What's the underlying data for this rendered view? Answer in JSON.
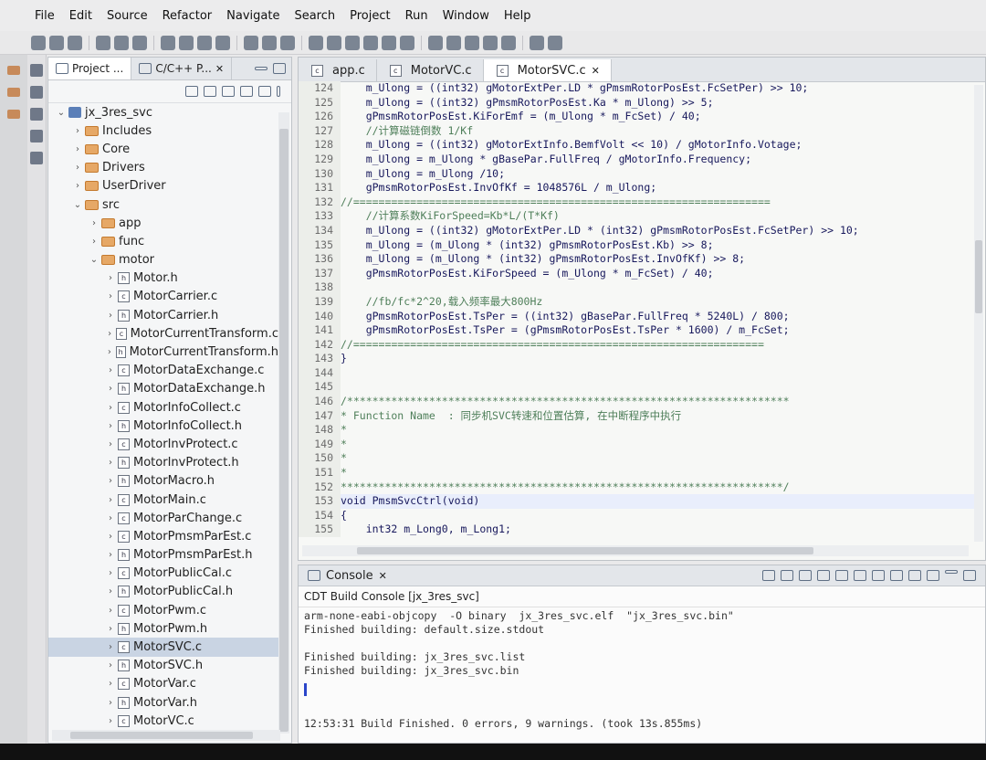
{
  "menu": [
    "File",
    "Edit",
    "Source",
    "Refactor",
    "Navigate",
    "Search",
    "Project",
    "Run",
    "Window",
    "Help"
  ],
  "project_explorer": {
    "tabs": [
      {
        "label": "Project ...",
        "close": ""
      },
      {
        "label": "C/C++ P...",
        "close": "✕"
      }
    ],
    "tree": [
      {
        "indent": 0,
        "chev": "⌄",
        "icon": "project",
        "label": "jx_3res_svc"
      },
      {
        "indent": 1,
        "chev": "›",
        "icon": "folder",
        "label": "Includes"
      },
      {
        "indent": 1,
        "chev": "›",
        "icon": "folder",
        "label": "Core"
      },
      {
        "indent": 1,
        "chev": "›",
        "icon": "folder",
        "label": "Drivers"
      },
      {
        "indent": 1,
        "chev": "›",
        "icon": "folder",
        "label": "UserDriver"
      },
      {
        "indent": 1,
        "chev": "⌄",
        "icon": "folder",
        "label": "src"
      },
      {
        "indent": 2,
        "chev": "›",
        "icon": "folder",
        "label": "app"
      },
      {
        "indent": 2,
        "chev": "›",
        "icon": "folder",
        "label": "func"
      },
      {
        "indent": 2,
        "chev": "⌄",
        "icon": "folder",
        "label": "motor"
      },
      {
        "indent": 3,
        "chev": "›",
        "icon": "h",
        "label": "Motor.h"
      },
      {
        "indent": 3,
        "chev": "›",
        "icon": "c",
        "label": "MotorCarrier.c"
      },
      {
        "indent": 3,
        "chev": "›",
        "icon": "h",
        "label": "MotorCarrier.h"
      },
      {
        "indent": 3,
        "chev": "›",
        "icon": "c",
        "label": "MotorCurrentTransform.c"
      },
      {
        "indent": 3,
        "chev": "›",
        "icon": "h",
        "label": "MotorCurrentTransform.h"
      },
      {
        "indent": 3,
        "chev": "›",
        "icon": "c",
        "label": "MotorDataExchange.c"
      },
      {
        "indent": 3,
        "chev": "›",
        "icon": "h",
        "label": "MotorDataExchange.h"
      },
      {
        "indent": 3,
        "chev": "›",
        "icon": "c",
        "label": "MotorInfoCollect.c"
      },
      {
        "indent": 3,
        "chev": "›",
        "icon": "h",
        "label": "MotorInfoCollect.h"
      },
      {
        "indent": 3,
        "chev": "›",
        "icon": "c",
        "label": "MotorInvProtect.c"
      },
      {
        "indent": 3,
        "chev": "›",
        "icon": "h",
        "label": "MotorInvProtect.h"
      },
      {
        "indent": 3,
        "chev": "›",
        "icon": "h",
        "label": "MotorMacro.h"
      },
      {
        "indent": 3,
        "chev": "›",
        "icon": "c",
        "label": "MotorMain.c"
      },
      {
        "indent": 3,
        "chev": "›",
        "icon": "c",
        "label": "MotorParChange.c"
      },
      {
        "indent": 3,
        "chev": "›",
        "icon": "c",
        "label": "MotorPmsmParEst.c"
      },
      {
        "indent": 3,
        "chev": "›",
        "icon": "h",
        "label": "MotorPmsmParEst.h"
      },
      {
        "indent": 3,
        "chev": "›",
        "icon": "c",
        "label": "MotorPublicCal.c"
      },
      {
        "indent": 3,
        "chev": "›",
        "icon": "h",
        "label": "MotorPublicCal.h"
      },
      {
        "indent": 3,
        "chev": "›",
        "icon": "c",
        "label": "MotorPwm.c"
      },
      {
        "indent": 3,
        "chev": "›",
        "icon": "h",
        "label": "MotorPwm.h"
      },
      {
        "indent": 3,
        "chev": "›",
        "icon": "c",
        "label": "MotorSVC.c",
        "selected": true
      },
      {
        "indent": 3,
        "chev": "›",
        "icon": "h",
        "label": "MotorSVC.h"
      },
      {
        "indent": 3,
        "chev": "›",
        "icon": "c",
        "label": "MotorVar.c"
      },
      {
        "indent": 3,
        "chev": "›",
        "icon": "h",
        "label": "MotorVar.h"
      },
      {
        "indent": 3,
        "chev": "›",
        "icon": "c",
        "label": "MotorVC.c"
      }
    ]
  },
  "editor": {
    "tabs": [
      {
        "label": "app.c",
        "active": false,
        "close": ""
      },
      {
        "label": "MotorVC.c",
        "active": false,
        "close": ""
      },
      {
        "label": "MotorSVC.c",
        "active": true,
        "close": "✕"
      }
    ],
    "lines": [
      {
        "n": "124",
        "t": "    m_Ulong = ((int32) gMotorExtPer.LD * gPmsmRotorPosEst.FcSetPer) >> 10;"
      },
      {
        "n": "125",
        "t": "    m_Ulong = ((int32) gPmsmRotorPosEst.Ka * m_Ulong) >> 5;"
      },
      {
        "n": "126",
        "t": "    gPmsmRotorPosEst.KiForEmf = (m_Ulong * m_FcSet) / 40;"
      },
      {
        "n": "127",
        "t": "    //计算磁链倒数 1/Kf",
        "c": true
      },
      {
        "n": "128",
        "t": "    m_Ulong = ((int32) gMotorExtInfo.BemfVolt << 10) / gMotorInfo.Votage;"
      },
      {
        "n": "129",
        "t": "    m_Ulong = m_Ulong * gBasePar.FullFreq / gMotorInfo.Frequency;"
      },
      {
        "n": "130",
        "t": "    m_Ulong = m_Ulong /10;"
      },
      {
        "n": "131",
        "t": "    gPmsmRotorPosEst.InvOfKf = 1048576L / m_Ulong;"
      },
      {
        "n": "132",
        "t": "//==================================================================",
        "c": true
      },
      {
        "n": "133",
        "t": "    //计算系数KiForSpeed=Kb*L/(T*Kf)",
        "c": true
      },
      {
        "n": "134",
        "t": "    m_Ulong = ((int32) gMotorExtPer.LD * (int32) gPmsmRotorPosEst.FcSetPer) >> 10;"
      },
      {
        "n": "135",
        "t": "    m_Ulong = (m_Ulong * (int32) gPmsmRotorPosEst.Kb) >> 8;"
      },
      {
        "n": "136",
        "t": "    m_Ulong = (m_Ulong * (int32) gPmsmRotorPosEst.InvOfKf) >> 8;"
      },
      {
        "n": "137",
        "t": "    gPmsmRotorPosEst.KiForSpeed = (m_Ulong * m_FcSet) / 40;"
      },
      {
        "n": "138",
        "t": ""
      },
      {
        "n": "139",
        "t": "    //fb/fc*2^20,载入频率最大800Hz",
        "c": true
      },
      {
        "n": "140",
        "t": "    gPmsmRotorPosEst.TsPer = ((int32) gBasePar.FullFreq * 5240L) / 800;"
      },
      {
        "n": "141",
        "t": "    gPmsmRotorPosEst.TsPer = (gPmsmRotorPosEst.TsPer * 1600) / m_FcSet;"
      },
      {
        "n": "142",
        "t": "//=================================================================",
        "c": true
      },
      {
        "n": "143",
        "t": "}"
      },
      {
        "n": "144",
        "t": ""
      },
      {
        "n": "145",
        "t": ""
      },
      {
        "n": "146",
        "t": "/**********************************************************************",
        "c": true
      },
      {
        "n": "147",
        "t": "* Function Name  : 同步机SVC转速和位置估算, 在中断程序中执行",
        "c": true
      },
      {
        "n": "148",
        "t": "*",
        "c": true
      },
      {
        "n": "149",
        "t": "*",
        "c": true
      },
      {
        "n": "150",
        "t": "*",
        "c": true
      },
      {
        "n": "151",
        "t": "*",
        "c": true
      },
      {
        "n": "152",
        "t": "**********************************************************************/",
        "c": true
      },
      {
        "n": "153",
        "t": "void PmsmSvcCtrl(void)",
        "cur": true
      },
      {
        "n": "154",
        "t": "{"
      },
      {
        "n": "155",
        "t": "    int32 m_Long0, m_Long1;"
      }
    ]
  },
  "console": {
    "tab_label": "Console",
    "tab_close": "✕",
    "title": "CDT Build Console [jx_3res_svc]",
    "lines": [
      "arm-none-eabi-objcopy  -O binary  jx_3res_svc.elf  \"jx_3res_svc.bin\"",
      "Finished building: default.size.stdout",
      "",
      "Finished building: jx_3res_svc.list",
      "Finished building: jx_3res_svc.bin"
    ],
    "status": "12:53:31 Build Finished. 0 errors, 9 warnings. (took 13s.855ms)"
  }
}
